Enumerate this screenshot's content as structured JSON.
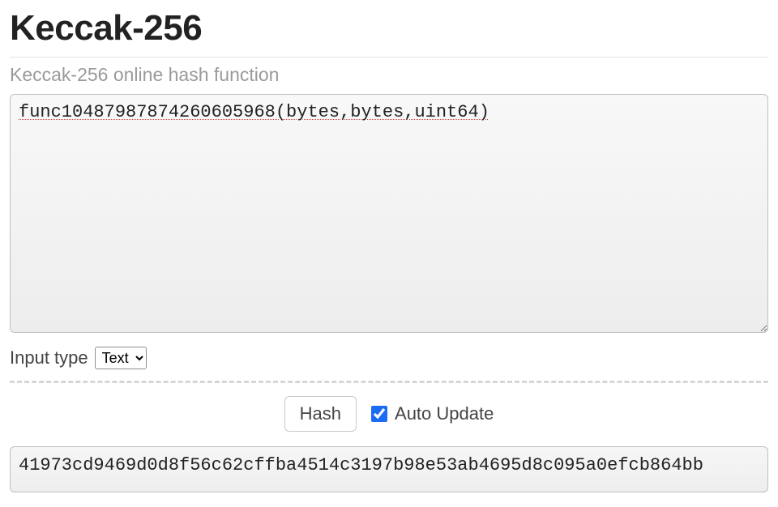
{
  "header": {
    "title": "Keccak-256",
    "subtitle": "Keccak-256 online hash function"
  },
  "input": {
    "value": "func10487987874260605968(bytes,bytes,uint64)"
  },
  "type_control": {
    "label": "Input type",
    "selected": "Text",
    "options": [
      "Text"
    ]
  },
  "actions": {
    "hash_label": "Hash",
    "auto_update_label": "Auto Update",
    "auto_update_checked": true
  },
  "output": {
    "value": "41973cd9469d0d8f56c62cffba4514c3197b98e53ab4695d8c095a0efcb864bb"
  }
}
